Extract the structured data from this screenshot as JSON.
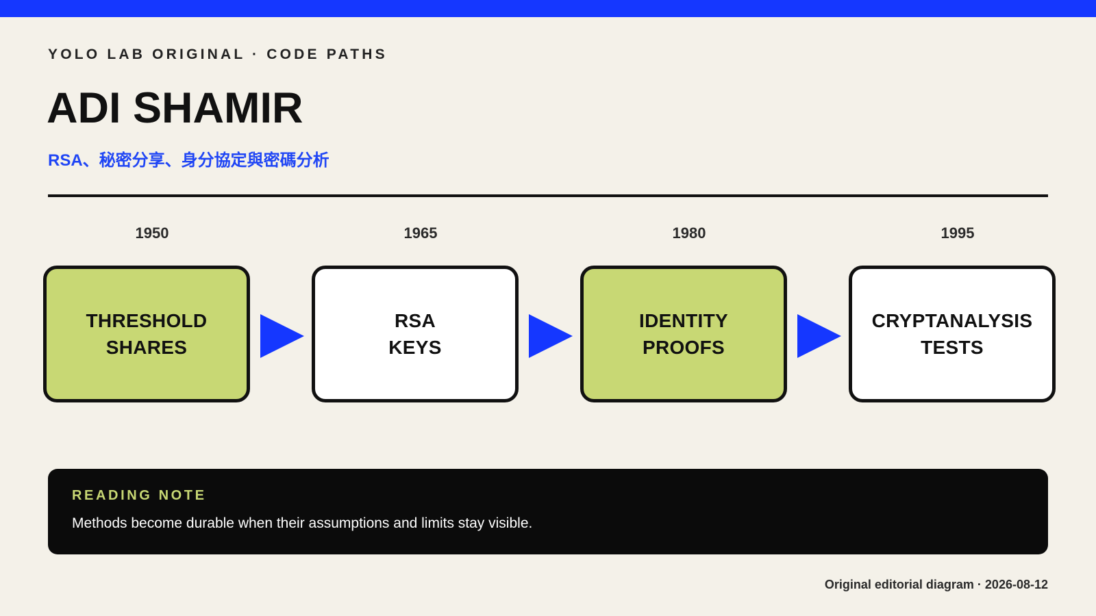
{
  "header": {
    "eyebrow": "YOLO LAB ORIGINAL · CODE PATHS",
    "title": "ADI SHAMIR",
    "subtitle": "RSA、秘密分享、身分協定與密碼分析"
  },
  "timeline": {
    "stages": [
      {
        "year": "1950",
        "label": "THRESHOLD\nSHARES",
        "style": "green"
      },
      {
        "year": "1965",
        "label": "RSA\nKEYS",
        "style": "white"
      },
      {
        "year": "1980",
        "label": "IDENTITY\nPROOFS",
        "style": "green"
      },
      {
        "year": "1995",
        "label": "CRYPTANALYSIS\nTESTS",
        "style": "white"
      }
    ]
  },
  "note": {
    "label": "READING NOTE",
    "text": "Methods become durable when their assumptions and limits stay visible."
  },
  "footer": {
    "text": "Original editorial diagram · 2026-08-12"
  },
  "colors": {
    "accent_blue": "#1537ff",
    "green_fill": "#c8d874",
    "background": "#f4f1e9",
    "dark": "#0b0b0b"
  }
}
